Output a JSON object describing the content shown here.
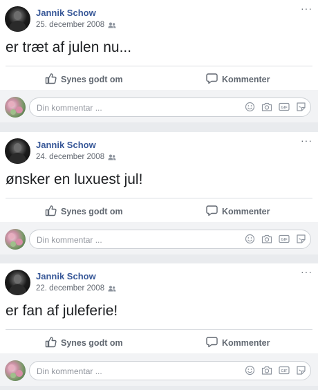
{
  "posts": [
    {
      "author": "Jannik Schow",
      "date": "25. december 2008",
      "text": "er træt af julen nu...",
      "like_label": "Synes godt om",
      "comment_label": "Kommenter",
      "comment_placeholder": "Din kommentar ..."
    },
    {
      "author": "Jannik Schow",
      "date": "24. december 2008",
      "text": "ønsker en luxuest jul!",
      "like_label": "Synes godt om",
      "comment_label": "Kommenter",
      "comment_placeholder": "Din kommentar ..."
    },
    {
      "author": "Jannik Schow",
      "date": "22. december 2008",
      "text": "er fan af juleferie!",
      "like_label": "Synes godt om",
      "comment_label": "Kommenter",
      "comment_placeholder": "Din kommentar ..."
    }
  ],
  "icons": {
    "audience": "friends-icon",
    "more": "more-options-icon",
    "like": "thumbs-up-icon",
    "comment": "comment-bubble-icon",
    "emoji": "emoji-icon",
    "camera": "camera-icon",
    "gif": "gif-icon",
    "sticker": "sticker-icon"
  },
  "colors": {
    "author_link": "#385898",
    "meta_text": "#616770",
    "action_text": "#606770",
    "feed_background": "#e9ebee"
  }
}
